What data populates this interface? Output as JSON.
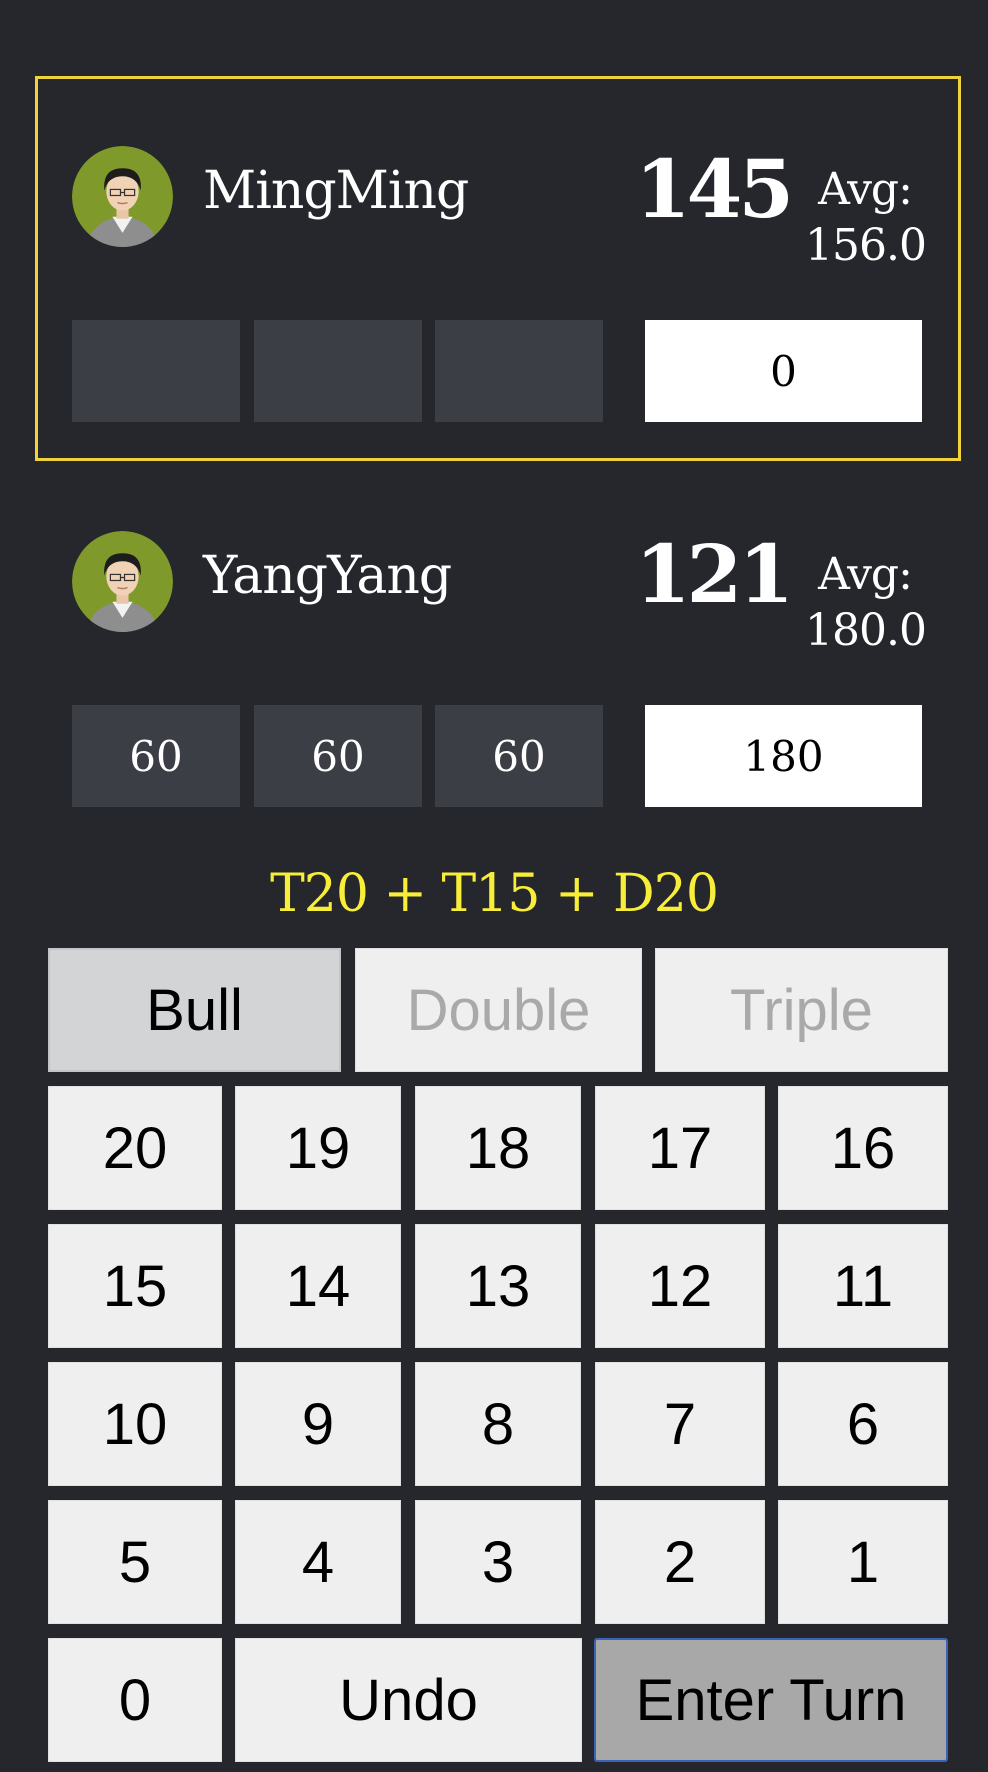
{
  "players": [
    {
      "name": "MingMing",
      "remaining": "145",
      "avg_label": "Avg:",
      "avg_value": "156.0",
      "darts": [
        "",
        "",
        ""
      ],
      "turn_total": "0",
      "active": true
    },
    {
      "name": "YangYang",
      "remaining": "121",
      "avg_label": "Avg:",
      "avg_value": "180.0",
      "darts": [
        "60",
        "60",
        "60"
      ],
      "turn_total": "180",
      "active": false
    }
  ],
  "checkout_hint": "T20 + T15 + D20",
  "modifiers": [
    "Bull",
    "Double",
    "Triple"
  ],
  "numbers": [
    "20",
    "19",
    "18",
    "17",
    "16",
    "15",
    "14",
    "13",
    "12",
    "11",
    "10",
    "9",
    "8",
    "7",
    "6",
    "5",
    "4",
    "3",
    "2",
    "1"
  ],
  "bottom": {
    "zero": "0",
    "undo": "Undo",
    "enter": "Enter Turn"
  },
  "colors": {
    "active_border": "#f2d23a",
    "checkout": "#f8ee3a",
    "background": "#25272c"
  }
}
